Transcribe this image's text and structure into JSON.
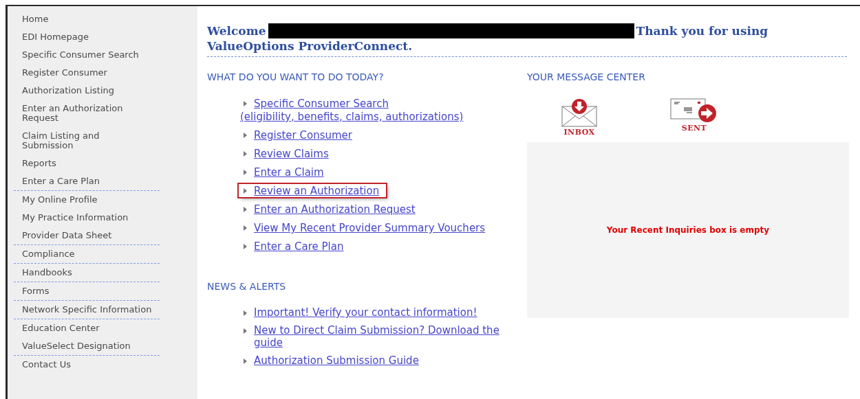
{
  "sidebar": {
    "items": [
      {
        "label": "Home",
        "divided": false
      },
      {
        "label": "EDI Homepage",
        "divided": false
      },
      {
        "label": "Specific Consumer Search",
        "divided": false
      },
      {
        "label": "Register Consumer",
        "divided": false
      },
      {
        "label": "Authorization Listing",
        "divided": false
      },
      {
        "label": "Enter an Authorization Request",
        "divided": false
      },
      {
        "label": "Claim Listing and Submission",
        "divided": false
      },
      {
        "label": "Reports",
        "divided": false
      },
      {
        "label": "Enter a Care Plan",
        "divided": true
      },
      {
        "label": "My Online Profile",
        "divided": false
      },
      {
        "label": "My Practice Information",
        "divided": false
      },
      {
        "label": "Provider Data Sheet",
        "divided": true
      },
      {
        "label": "Compliance",
        "divided": true
      },
      {
        "label": "Handbooks",
        "divided": true
      },
      {
        "label": "Forms",
        "divided": true
      },
      {
        "label": "Network Specific Information",
        "divided": true
      },
      {
        "label": "Education Center",
        "divided": false
      },
      {
        "label": "ValueSelect Designation",
        "divided": true
      },
      {
        "label": "Contact Us",
        "divided": false
      }
    ]
  },
  "welcome": {
    "greeting": "Welcome",
    "redacted": true,
    "message": "Thank you for using ValueOptions ProviderConnect."
  },
  "tasks": {
    "heading": "WHAT DO YOU WANT TO DO TODAY?",
    "links": [
      {
        "label": "Specific Consumer Search",
        "note": "(eligibility, benefits, claims, authorizations)",
        "highlighted": false
      },
      {
        "label": "Register Consumer",
        "highlighted": false
      },
      {
        "label": "Review Claims",
        "highlighted": false
      },
      {
        "label": "Enter a Claim",
        "highlighted": false
      },
      {
        "label": "Review an Authorization",
        "highlighted": true
      },
      {
        "label": "Enter an Authorization Request",
        "highlighted": false
      },
      {
        "label": "View My Recent Provider Summary Vouchers",
        "highlighted": false
      },
      {
        "label": "Enter a Care Plan",
        "highlighted": false
      }
    ]
  },
  "news": {
    "heading": "NEWS & ALERTS",
    "links": [
      {
        "label": "Important! Verify your contact information!"
      },
      {
        "label": "New to Direct Claim Submission? Download the guide"
      },
      {
        "label": "Authorization Submission Guide"
      }
    ]
  },
  "message_center": {
    "heading": "YOUR MESSAGE CENTER",
    "boxes": [
      {
        "kind": "inbox",
        "label": "INBOX"
      },
      {
        "kind": "sent",
        "label": "SENT"
      }
    ],
    "inquiries": "Your Recent Inquiries box is empty"
  }
}
